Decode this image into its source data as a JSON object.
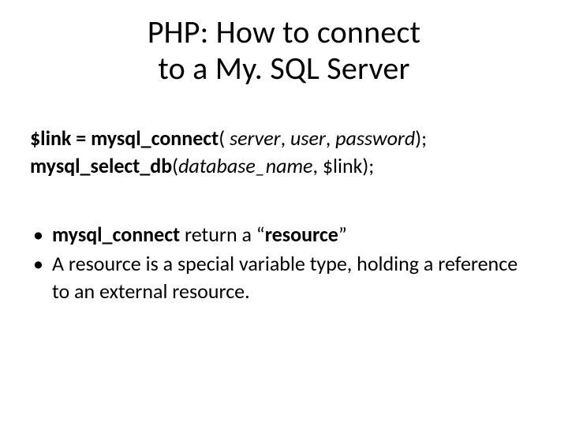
{
  "title_line1": "PHP: How to connect",
  "title_line2": "to a My. SQL Server",
  "code": {
    "l1_a": "$link = mysql_connect",
    "l1_b": "( ",
    "l1_c": "server",
    "l1_d": ", ",
    "l1_e": "user",
    "l1_f": ", ",
    "l1_g": "password",
    "l1_h": ");",
    "l2_a": "mysql_select_db",
    "l2_b": "(",
    "l2_c": "database_name",
    "l2_d": ", $link);"
  },
  "bullets": {
    "b1_a": "mysql_connect",
    "b1_b": " return a “",
    "b1_c": "resource",
    "b1_d": "”",
    "b2": "A resource is a special variable type, holding a reference to an external resource."
  }
}
